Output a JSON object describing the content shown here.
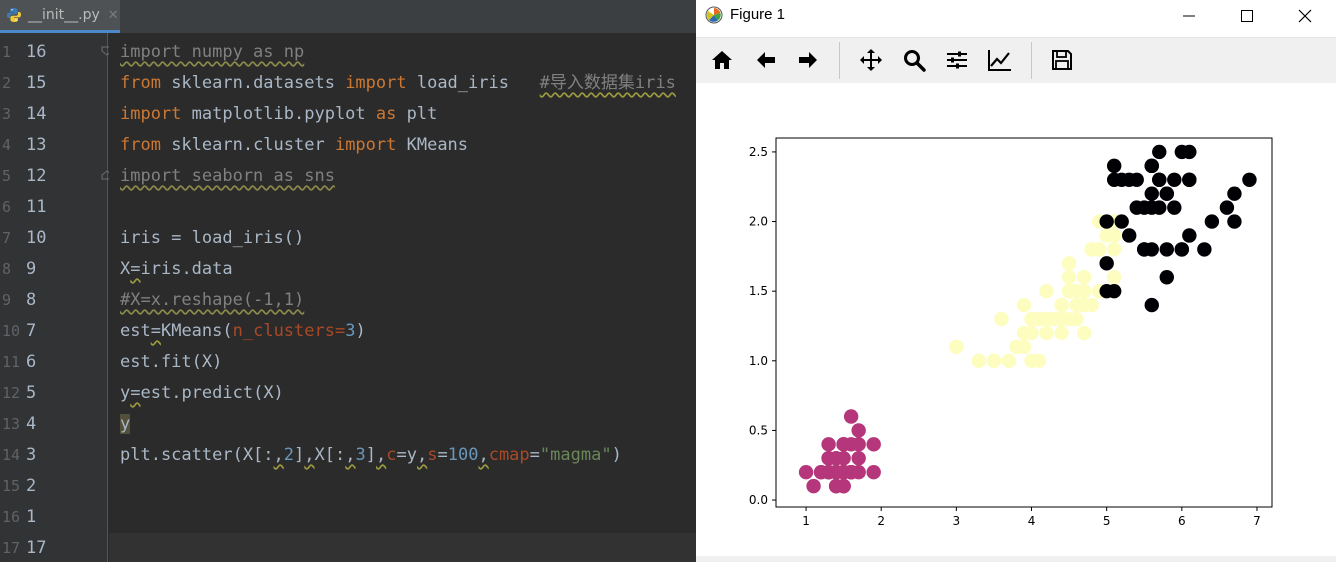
{
  "ide": {
    "tab": {
      "filename": "__init__.py",
      "close_glyph": "✕"
    },
    "gutter": [
      {
        "ln": "1",
        "rel": "16"
      },
      {
        "ln": "2",
        "rel": "15"
      },
      {
        "ln": "3",
        "rel": "14"
      },
      {
        "ln": "4",
        "rel": "13"
      },
      {
        "ln": "5",
        "rel": "12"
      },
      {
        "ln": "6",
        "rel": "11"
      },
      {
        "ln": "7",
        "rel": "10"
      },
      {
        "ln": "8",
        "rel": "9"
      },
      {
        "ln": "9",
        "rel": "8"
      },
      {
        "ln": "10",
        "rel": "7"
      },
      {
        "ln": "11",
        "rel": "6"
      },
      {
        "ln": "12",
        "rel": "5"
      },
      {
        "ln": "13",
        "rel": "4"
      },
      {
        "ln": "14",
        "rel": "3"
      },
      {
        "ln": "15",
        "rel": "2"
      },
      {
        "ln": "16",
        "rel": "1"
      },
      {
        "ln": "17",
        "rel": "17"
      }
    ],
    "code": {
      "l1": {
        "text": "import numpy as np"
      },
      "l2": {
        "kw1": "from",
        "mod": " sklearn.datasets ",
        "kw2": "import",
        "name": " load_iris   ",
        "comment": "#导入数据集iris"
      },
      "l3": {
        "kw1": "import",
        "mod": " matplotlib.pyplot ",
        "kw2": "as",
        "name": " plt"
      },
      "l4": {
        "kw1": "from",
        "mod": " sklearn.cluster ",
        "kw2": "import",
        "name": " KMeans"
      },
      "l5": {
        "text": "import seaborn as sns"
      },
      "l7": {
        "text": "iris = load_iris()"
      },
      "l8": {
        "a": "X",
        "b": "=",
        "c": "iris.data"
      },
      "l9": {
        "text": "#X=x.reshape(-1,1)"
      },
      "l10": {
        "a": "est",
        "b": "=",
        "c": "KMeans(",
        "kwarg": "n_clusters",
        "eq": "=",
        "num": "3",
        "close": ")"
      },
      "l11": {
        "text": "est.fit(X)"
      },
      "l12": {
        "a": "y",
        "b": "=",
        "c": "est.predict(X)"
      },
      "l13": {
        "text": "y"
      },
      "l14": {
        "p1": "plt.scatter(X[:",
        "c1": ",",
        "n1": "2",
        "p2": "]",
        "c2": ",",
        "p3": "X[:",
        "c3": ",",
        "n2": "3",
        "p4": "]",
        "c4": ",",
        "k1": "c",
        "e1": "=y",
        "c5": ",",
        "k2": "s",
        "e2": "=",
        "n3": "100",
        "c6": ",",
        "k3": "cmap",
        "e3": "=",
        "s1": "\"magma\"",
        "p5": ")"
      }
    }
  },
  "figure": {
    "window_title": "Figure 1",
    "toolbar_icons": [
      "home-icon",
      "back-arrow-icon",
      "forward-arrow-icon",
      "pan-icon",
      "zoom-icon",
      "subplots-icon",
      "edit-axes-icon",
      "save-icon"
    ]
  },
  "colors": {
    "cluster_a": "#000004",
    "cluster_b": "#b5367a",
    "cluster_c": "#fcfdbf"
  },
  "chart_data": {
    "type": "scatter",
    "title": "",
    "xlabel": "",
    "ylabel": "",
    "xlim": [
      0.6,
      7.2
    ],
    "ylim": [
      -0.05,
      2.6
    ],
    "xticks": [
      "1",
      "2",
      "3",
      "4",
      "5",
      "6",
      "7"
    ],
    "yticks": [
      "0.0",
      "0.5",
      "1.0",
      "1.5",
      "2.0",
      "2.5"
    ],
    "xtick_values": [
      1,
      2,
      3,
      4,
      5,
      6,
      7
    ],
    "ytick_values": [
      0.0,
      0.5,
      1.0,
      1.5,
      2.0,
      2.5
    ],
    "grid": false,
    "series": [
      {
        "color": "#b5367a",
        "points": [
          [
            1.4,
            0.2
          ],
          [
            1.4,
            0.2
          ],
          [
            1.3,
            0.2
          ],
          [
            1.5,
            0.2
          ],
          [
            1.4,
            0.2
          ],
          [
            1.7,
            0.4
          ],
          [
            1.4,
            0.3
          ],
          [
            1.5,
            0.2
          ],
          [
            1.4,
            0.2
          ],
          [
            1.5,
            0.1
          ],
          [
            1.5,
            0.2
          ],
          [
            1.6,
            0.2
          ],
          [
            1.4,
            0.1
          ],
          [
            1.1,
            0.1
          ],
          [
            1.2,
            0.2
          ],
          [
            1.5,
            0.4
          ],
          [
            1.3,
            0.4
          ],
          [
            1.4,
            0.3
          ],
          [
            1.7,
            0.3
          ],
          [
            1.5,
            0.3
          ],
          [
            1.7,
            0.2
          ],
          [
            1.5,
            0.4
          ],
          [
            1.0,
            0.2
          ],
          [
            1.7,
            0.5
          ],
          [
            1.9,
            0.2
          ],
          [
            1.6,
            0.2
          ],
          [
            1.6,
            0.4
          ],
          [
            1.5,
            0.2
          ],
          [
            1.4,
            0.2
          ],
          [
            1.6,
            0.2
          ],
          [
            1.6,
            0.2
          ],
          [
            1.5,
            0.4
          ],
          [
            1.5,
            0.1
          ],
          [
            1.4,
            0.2
          ],
          [
            1.5,
            0.2
          ],
          [
            1.2,
            0.2
          ],
          [
            1.3,
            0.2
          ],
          [
            1.4,
            0.1
          ],
          [
            1.3,
            0.2
          ],
          [
            1.5,
            0.2
          ],
          [
            1.3,
            0.3
          ],
          [
            1.3,
            0.3
          ],
          [
            1.3,
            0.2
          ],
          [
            1.6,
            0.6
          ],
          [
            1.9,
            0.4
          ],
          [
            1.4,
            0.3
          ],
          [
            1.6,
            0.2
          ],
          [
            1.4,
            0.2
          ],
          [
            1.5,
            0.2
          ],
          [
            1.4,
            0.2
          ]
        ]
      },
      {
        "color": "#fcfdbf",
        "points": [
          [
            4.7,
            1.4
          ],
          [
            4.5,
            1.5
          ],
          [
            4.0,
            1.3
          ],
          [
            4.6,
            1.5
          ],
          [
            4.5,
            1.3
          ],
          [
            4.7,
            1.6
          ],
          [
            3.3,
            1.0
          ],
          [
            4.6,
            1.3
          ],
          [
            3.9,
            1.4
          ],
          [
            3.5,
            1.0
          ],
          [
            4.2,
            1.5
          ],
          [
            4.0,
            1.0
          ],
          [
            4.7,
            1.4
          ],
          [
            3.6,
            1.3
          ],
          [
            4.4,
            1.4
          ],
          [
            4.5,
            1.5
          ],
          [
            4.1,
            1.0
          ],
          [
            4.5,
            1.5
          ],
          [
            3.9,
            1.1
          ],
          [
            4.8,
            1.8
          ],
          [
            4.0,
            1.3
          ],
          [
            4.9,
            1.5
          ],
          [
            4.7,
            1.2
          ],
          [
            4.3,
            1.3
          ],
          [
            4.4,
            1.4
          ],
          [
            4.8,
            1.4
          ],
          [
            5.0,
            1.7
          ],
          [
            4.5,
            1.5
          ],
          [
            3.5,
            1.0
          ],
          [
            3.8,
            1.1
          ],
          [
            3.7,
            1.0
          ],
          [
            3.9,
            1.2
          ],
          [
            5.1,
            1.6
          ],
          [
            4.5,
            1.5
          ],
          [
            4.5,
            1.6
          ],
          [
            4.7,
            1.5
          ],
          [
            4.4,
            1.3
          ],
          [
            4.1,
            1.3
          ],
          [
            4.0,
            1.3
          ],
          [
            4.4,
            1.2
          ],
          [
            4.6,
            1.4
          ],
          [
            4.0,
            1.2
          ],
          [
            3.3,
            1.0
          ],
          [
            4.2,
            1.3
          ],
          [
            4.2,
            1.2
          ],
          [
            4.2,
            1.3
          ],
          [
            4.3,
            1.3
          ],
          [
            3.0,
            1.1
          ],
          [
            4.1,
            1.3
          ],
          [
            5.1,
            1.9
          ],
          [
            4.5,
            1.7
          ],
          [
            5.0,
            2.0
          ],
          [
            4.9,
            1.8
          ],
          [
            4.9,
            1.8
          ],
          [
            4.8,
            1.8
          ],
          [
            5.1,
            1.5
          ],
          [
            5.0,
            1.5
          ],
          [
            5.1,
            2.4
          ],
          [
            5.1,
            1.8
          ],
          [
            4.8,
            1.8
          ],
          [
            5.1,
            2.0
          ],
          [
            5.0,
            1.9
          ],
          [
            5.1,
            2.3
          ],
          [
            4.9,
            2.0
          ],
          [
            4.8,
            1.8
          ],
          [
            5.1,
            1.9
          ],
          [
            4.9,
            1.5
          ]
        ]
      },
      {
        "color": "#000004",
        "points": [
          [
            6.0,
            2.5
          ],
          [
            5.9,
            2.1
          ],
          [
            5.6,
            1.8
          ],
          [
            5.8,
            2.2
          ],
          [
            6.6,
            2.1
          ],
          [
            6.3,
            1.8
          ],
          [
            5.8,
            1.8
          ],
          [
            6.1,
            2.5
          ],
          [
            5.3,
            1.9
          ],
          [
            5.5,
            2.1
          ],
          [
            5.0,
            2.0
          ],
          [
            5.1,
            2.4
          ],
          [
            5.3,
            2.3
          ],
          [
            5.5,
            1.8
          ],
          [
            6.7,
            2.2
          ],
          [
            6.9,
            2.3
          ],
          [
            5.0,
            1.5
          ],
          [
            5.7,
            2.3
          ],
          [
            6.7,
            2.0
          ],
          [
            5.7,
            2.1
          ],
          [
            6.0,
            1.8
          ],
          [
            5.6,
            2.1
          ],
          [
            5.8,
            1.6
          ],
          [
            6.1,
            1.9
          ],
          [
            6.4,
            2.0
          ],
          [
            5.6,
            2.2
          ],
          [
            5.1,
            1.5
          ],
          [
            5.6,
            1.4
          ],
          [
            6.1,
            2.3
          ],
          [
            5.6,
            2.4
          ],
          [
            5.5,
            1.8
          ],
          [
            5.4,
            2.1
          ],
          [
            5.6,
            2.4
          ],
          [
            5.1,
            2.3
          ],
          [
            5.9,
            2.3
          ],
          [
            5.7,
            2.5
          ],
          [
            5.2,
            2.3
          ],
          [
            5.0,
            1.7
          ],
          [
            5.2,
            2.0
          ],
          [
            5.4,
            2.3
          ],
          [
            6.1,
            2.3
          ],
          [
            5.8,
            2.2
          ],
          [
            6.0,
            1.8
          ],
          [
            5.7,
            2.3
          ]
        ]
      }
    ]
  }
}
